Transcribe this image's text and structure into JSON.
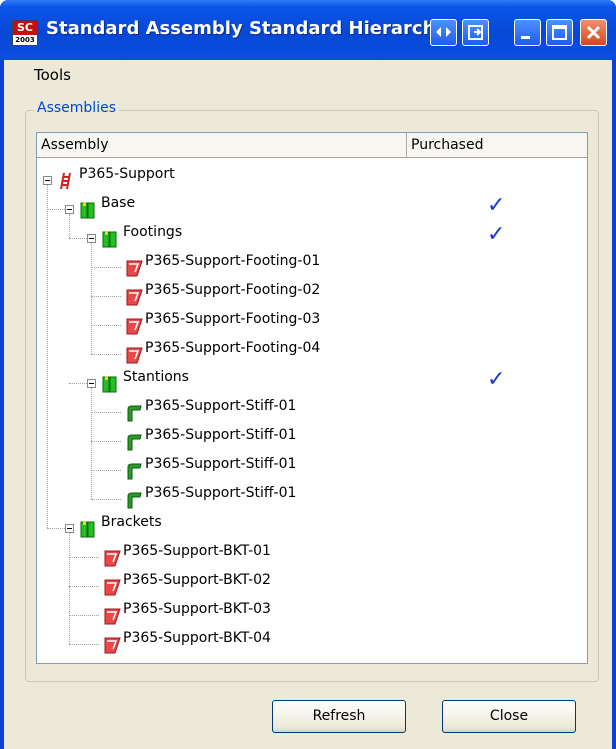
{
  "window": {
    "title": "Standard Assembly Standard Hierarchy",
    "app_icon_top": "SC",
    "app_icon_bottom": "2003"
  },
  "menu": {
    "tools": "Tools"
  },
  "group": {
    "label": "Assemblies"
  },
  "tree": {
    "headers": {
      "assembly": "Assembly",
      "purchased": "Purchased"
    },
    "rows": [
      {
        "label": "P365-Support",
        "icon": "ladder-icon",
        "purchased": false
      },
      {
        "label": "Base",
        "icon": "assembly-icon",
        "purchased": true
      },
      {
        "label": "Footings",
        "icon": "assembly-icon",
        "purchased": true
      },
      {
        "label": "P365-Support-Footing-01",
        "icon": "plate-part-icon",
        "purchased": false
      },
      {
        "label": "P365-Support-Footing-02",
        "icon": "plate-part-icon",
        "purchased": false
      },
      {
        "label": "P365-Support-Footing-03",
        "icon": "plate-part-icon",
        "purchased": false
      },
      {
        "label": "P365-Support-Footing-04",
        "icon": "plate-part-icon",
        "purchased": false
      },
      {
        "label": "Stantions",
        "icon": "assembly-icon",
        "purchased": true
      },
      {
        "label": "P365-Support-Stiff-01",
        "icon": "stiffener-part-icon",
        "purchased": false
      },
      {
        "label": "P365-Support-Stiff-01",
        "icon": "stiffener-part-icon",
        "purchased": false
      },
      {
        "label": "P365-Support-Stiff-01",
        "icon": "stiffener-part-icon",
        "purchased": false
      },
      {
        "label": "P365-Support-Stiff-01",
        "icon": "stiffener-part-icon",
        "purchased": false
      },
      {
        "label": "Brackets",
        "icon": "assembly-icon",
        "purchased": false
      },
      {
        "label": "P365-Support-BKT-01",
        "icon": "plate-part-icon",
        "purchased": false
      },
      {
        "label": "P365-Support-BKT-02",
        "icon": "plate-part-icon",
        "purchased": false
      },
      {
        "label": "P365-Support-BKT-03",
        "icon": "plate-part-icon",
        "purchased": false
      },
      {
        "label": "P365-Support-BKT-04",
        "icon": "plate-part-icon",
        "purchased": false
      }
    ]
  },
  "buttons": {
    "refresh": "Refresh",
    "close": "Close"
  },
  "colors": {
    "title_bar": "#0a55e8",
    "dialog": "#ece9d8",
    "checkmark": "#1a3ccc",
    "group_label": "#0046d5"
  }
}
